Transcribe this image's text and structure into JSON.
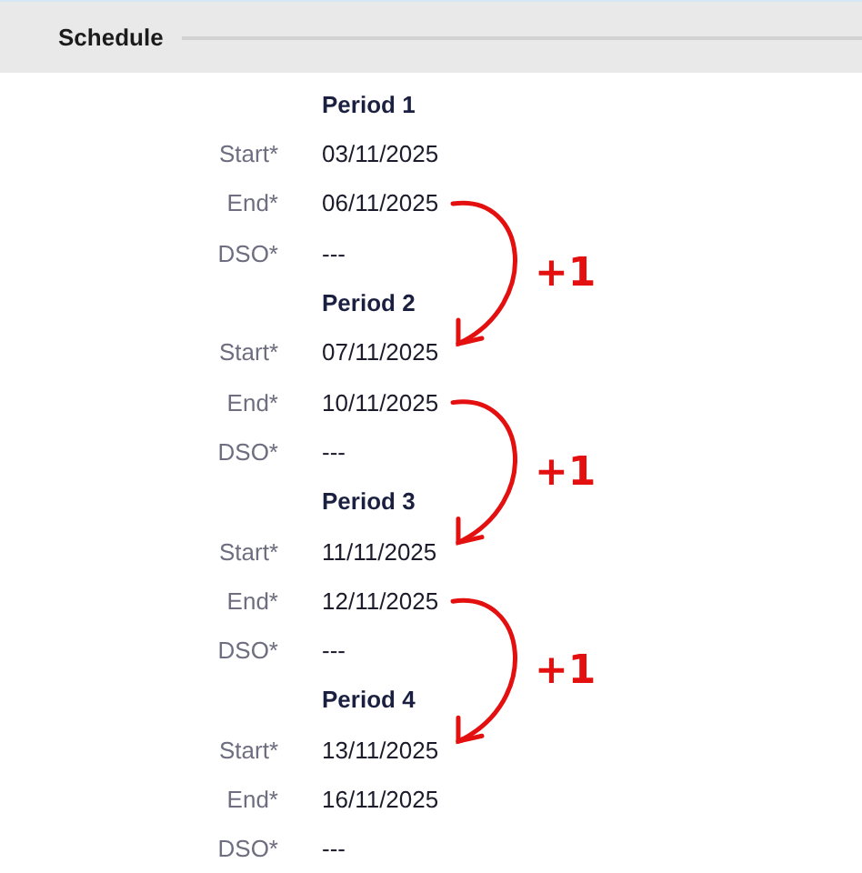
{
  "section": {
    "title": "Schedule"
  },
  "periods": [
    {
      "title": "Period 1",
      "fields": [
        {
          "label": "Start*",
          "value": "03/11/2025"
        },
        {
          "label": "End*",
          "value": "06/11/2025"
        },
        {
          "label": "DSO*",
          "value": "---"
        }
      ]
    },
    {
      "title": "Period 2",
      "fields": [
        {
          "label": "Start*",
          "value": "07/11/2025"
        },
        {
          "label": "End*",
          "value": "10/11/2025"
        },
        {
          "label": "DSO*",
          "value": "---"
        }
      ]
    },
    {
      "title": "Period 3",
      "fields": [
        {
          "label": "Start*",
          "value": "11/11/2025"
        },
        {
          "label": "End*",
          "value": "12/11/2025"
        },
        {
          "label": "DSO*",
          "value": "---"
        }
      ]
    },
    {
      "title": "Period 4",
      "fields": [
        {
          "label": "Start*",
          "value": "13/11/2025"
        },
        {
          "label": "End*",
          "value": "16/11/2025"
        },
        {
          "label": "DSO*",
          "value": "---"
        }
      ]
    }
  ],
  "annotations": [
    {
      "label": "+1"
    },
    {
      "label": "+1"
    },
    {
      "label": "+1"
    }
  ]
}
